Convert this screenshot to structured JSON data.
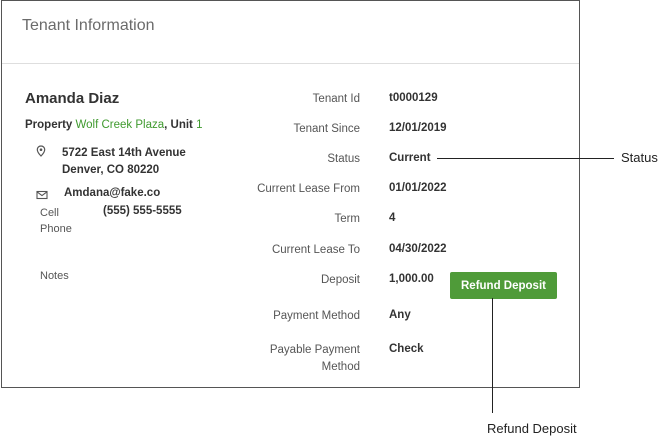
{
  "card": {
    "title": "Tenant Information"
  },
  "tenant": {
    "name": "Amanda Diaz",
    "property_label": "Property",
    "property_name": "Wolf Creek Plaza",
    "unit_label": ", Unit",
    "unit_number": "1",
    "address_line1": "5722 East 14th Avenue",
    "address_line2": "Denver, CO 80220",
    "email": "Amdana@fake.co",
    "cell_label": "Cell Phone",
    "cell_value": "(555) 555-5555",
    "notes_label": "Notes"
  },
  "fields": [
    {
      "label": "Tenant Id",
      "value": "t0000129"
    },
    {
      "label": "Tenant Since",
      "value": "12/01/2019"
    },
    {
      "label": "Status",
      "value": "Current"
    },
    {
      "label": "Current Lease From",
      "value": "01/01/2022"
    },
    {
      "label": "Term",
      "value": "4"
    },
    {
      "label": "Current Lease To",
      "value": "04/30/2022"
    },
    {
      "label": "Deposit",
      "value": "1,000.00"
    },
    {
      "label": "Payment Method",
      "value": "Any"
    },
    {
      "label": "Payable Payment Method",
      "value": "Check"
    }
  ],
  "buttons": {
    "refund_deposit": "Refund Deposit"
  },
  "callouts": {
    "status": "Status",
    "refund_deposit": "Refund Deposit"
  },
  "icons": {
    "address": "location-pin-icon",
    "email": "envelope-icon"
  },
  "colors": {
    "accent_green": "#4f9b39",
    "link_green": "#3f9a2e"
  }
}
